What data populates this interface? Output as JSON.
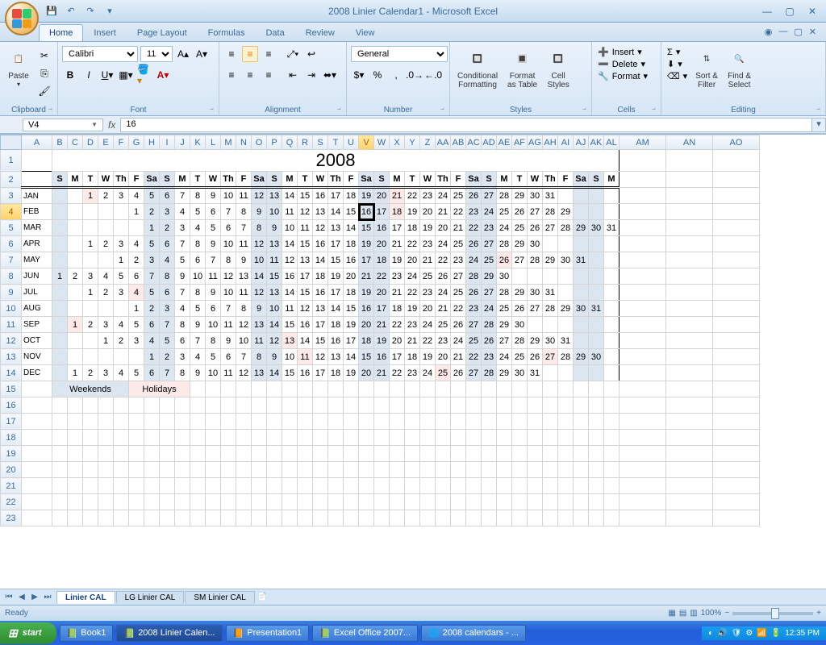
{
  "app": {
    "title": "2008 Linier Calendar1 - Microsoft Excel"
  },
  "tabs": [
    "Home",
    "Insert",
    "Page Layout",
    "Formulas",
    "Data",
    "Review",
    "View"
  ],
  "active_tab_index": 0,
  "ribbon": {
    "clipboard": {
      "label": "Clipboard",
      "paste": "Paste"
    },
    "font": {
      "label": "Font",
      "name": "Calibri",
      "size": "11"
    },
    "alignment": {
      "label": "Alignment"
    },
    "number": {
      "label": "Number",
      "format": "General"
    },
    "styles": {
      "label": "Styles",
      "conditional": "Conditional\nFormatting",
      "table": "Format\nas Table",
      "cell": "Cell\nStyles"
    },
    "cells": {
      "label": "Cells",
      "insert": "Insert",
      "delete": "Delete",
      "format": "Format"
    },
    "editing": {
      "label": "Editing",
      "sort": "Sort &\nFilter",
      "find": "Find &\nSelect"
    }
  },
  "name_box": "V4",
  "formula_value": "16",
  "columns": [
    "A",
    "B",
    "C",
    "D",
    "E",
    "F",
    "G",
    "H",
    "I",
    "J",
    "K",
    "L",
    "M",
    "N",
    "O",
    "P",
    "Q",
    "R",
    "S",
    "T",
    "U",
    "V",
    "W",
    "X",
    "Y",
    "Z",
    "AA",
    "AB",
    "AC",
    "AD",
    "AE",
    "AF",
    "AG",
    "AH",
    "AI",
    "AJ",
    "AK",
    "AL",
    "AM",
    "AN",
    "AO"
  ],
  "active_col": "V",
  "row_numbers": [
    1,
    2,
    3,
    4,
    5,
    6,
    7,
    8,
    9,
    10,
    11,
    12,
    13,
    14,
    15,
    16,
    17,
    18,
    19,
    20,
    21,
    22,
    23
  ],
  "active_row": 4,
  "year": "2008",
  "day_headers": [
    "S",
    "M",
    "T",
    "W",
    "Th",
    "F",
    "Sa",
    "S",
    "M",
    "T",
    "W",
    "Th",
    "F",
    "Sa",
    "S",
    "M",
    "T",
    "W",
    "Th",
    "F",
    "Sa",
    "S",
    "M",
    "T",
    "W",
    "Th",
    "F",
    "Sa",
    "S",
    "M",
    "T",
    "W",
    "Th",
    "F",
    "Sa",
    "S",
    "M"
  ],
  "weekend_cols": [
    0,
    6,
    7,
    13,
    14,
    20,
    21,
    27,
    28,
    34,
    35
  ],
  "months": [
    {
      "name": "JAN",
      "start": 2,
      "days": 31,
      "holidays": [
        1,
        21
      ]
    },
    {
      "name": "FEB",
      "start": 5,
      "days": 29,
      "holidays": [
        18
      ]
    },
    {
      "name": "MAR",
      "start": 6,
      "days": 31,
      "holidays": []
    },
    {
      "name": "APR",
      "start": 2,
      "days": 30,
      "holidays": []
    },
    {
      "name": "MAY",
      "start": 4,
      "days": 31,
      "holidays": [
        26
      ]
    },
    {
      "name": "JUN",
      "start": 0,
      "days": 30,
      "holidays": []
    },
    {
      "name": "JUL",
      "start": 2,
      "days": 31,
      "holidays": [
        4
      ]
    },
    {
      "name": "AUG",
      "start": 5,
      "days": 31,
      "holidays": []
    },
    {
      "name": "SEP",
      "start": 1,
      "days": 30,
      "holidays": [
        1
      ]
    },
    {
      "name": "OCT",
      "start": 3,
      "days": 31,
      "holidays": [
        13
      ]
    },
    {
      "name": "NOV",
      "start": 6,
      "days": 30,
      "holidays": [
        11,
        27
      ]
    },
    {
      "name": "DEC",
      "start": 1,
      "days": 31,
      "holidays": [
        25
      ]
    }
  ],
  "today": {
    "row": 4,
    "dayIndex": 21
  },
  "legend": {
    "weekends": "Weekends",
    "holidays": "Holidays"
  },
  "sheets": [
    "Linier CAL",
    "LG Linier CAL",
    "SM Linier CAL"
  ],
  "active_sheet": 0,
  "status": "Ready",
  "zoom": "100%",
  "taskbar": {
    "start": "start",
    "items": [
      "Book1",
      "2008 Linier Calen...",
      "Presentation1",
      "Excel Office 2007...",
      "2008 calendars - ..."
    ],
    "active_item": 1,
    "time": "12:35 PM"
  }
}
